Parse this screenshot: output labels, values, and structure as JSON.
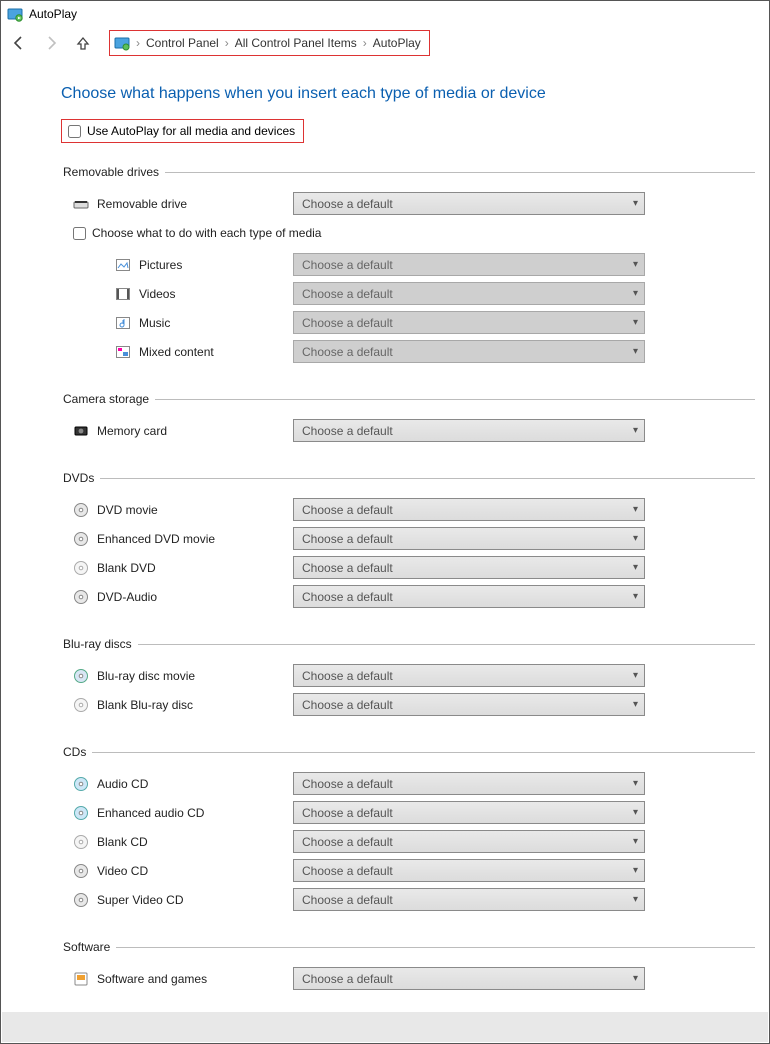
{
  "window_title": "AutoPlay",
  "breadcrumbs": [
    "Control Panel",
    "All Control Panel Items",
    "AutoPlay"
  ],
  "heading": "Choose what happens when you insert each type of media or device",
  "use_autoplay_label": "Use AutoPlay for all media and devices",
  "choose_each_label": "Choose what to do with each type of media",
  "default_choice": "Choose a default",
  "sections": {
    "removable": {
      "title": "Removable drives",
      "item": "Removable drive",
      "sub": [
        "Pictures",
        "Videos",
        "Music",
        "Mixed content"
      ]
    },
    "camera": {
      "title": "Camera storage",
      "items": [
        "Memory card"
      ]
    },
    "dvds": {
      "title": "DVDs",
      "items": [
        "DVD movie",
        "Enhanced DVD movie",
        "Blank DVD",
        "DVD-Audio"
      ]
    },
    "bluray": {
      "title": "Blu-ray discs",
      "items": [
        "Blu-ray disc movie",
        "Blank Blu-ray disc"
      ]
    },
    "cds": {
      "title": "CDs",
      "items": [
        "Audio CD",
        "Enhanced audio CD",
        "Blank CD",
        "Video CD",
        "Super Video CD"
      ]
    },
    "software": {
      "title": "Software",
      "items": [
        "Software and games"
      ]
    }
  }
}
